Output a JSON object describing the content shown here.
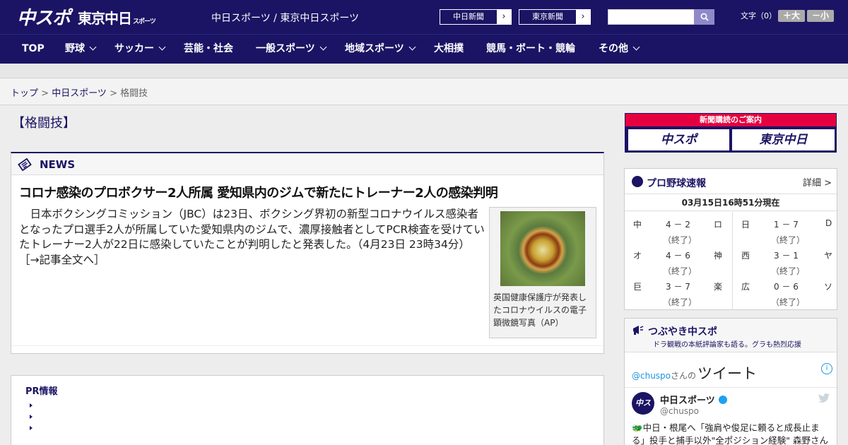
{
  "header": {
    "logo_main": "中スポ",
    "logo_tokyo": "東京中日",
    "logo_tokyo_small": "スポーツ",
    "site_title": "中日スポーツ / 東京中日スポーツ",
    "links": [
      {
        "label": "中日新聞",
        "arrow": "›"
      },
      {
        "label": "東京新聞",
        "arrow": "›"
      }
    ],
    "search_placeholder": "",
    "font_label": "文字（0）",
    "font_up": "＋大",
    "font_down": "－小"
  },
  "nav": {
    "items": [
      {
        "label": "TOP"
      },
      {
        "label": "野球"
      },
      {
        "label": "サッカー"
      },
      {
        "label": "芸能・社会"
      },
      {
        "label": "一般スポーツ"
      },
      {
        "label": "地域スポーツ"
      },
      {
        "label": "大相撲"
      },
      {
        "label": "競馬・ボート・競輪"
      },
      {
        "label": "その他"
      }
    ]
  },
  "breadcrumb": {
    "top": "トップ",
    "sep1": " > ",
    "section": "中日スポーツ",
    "sep2": " > ",
    "current": "格闘技"
  },
  "page_title": "【格闘技】",
  "news": {
    "label": "NEWS",
    "headline": "コロナ感染のプロボクサー2人所属 愛知県内のジムで新たにトレーナー2人の感染判明",
    "body": "日本ボクシングコミッション（JBC）は23日、ボクシング界初の新型コロナウイルス感染者となったプロ選手2人が所属していた愛知県内のジムで、濃厚接触者としてPCR検査を受けていたトレーナー2人が22日に感染していたことが判明したと発表した。（4月23日 23時34分）",
    "more_link": "［→記事全文へ］",
    "photo_caption": "英国健康保護庁が発表したコロナウイルスの電子顕微鏡写真（AP）"
  },
  "pr": {
    "title": "PR情報"
  },
  "subscription": {
    "title": "新聞購読のご案内",
    "left": "中スポ",
    "right": "東京中日"
  },
  "baseball": {
    "title": "プロ野球速報",
    "more": "詳細 >",
    "time": "03月15日16時51分現在",
    "games": [
      {
        "home": "中",
        "score": "4 － 2",
        "away": "ロ",
        "status": "（終了）"
      },
      {
        "home": "日",
        "score": "1 － 7",
        "away": "D",
        "status": "（終了）"
      },
      {
        "home": "オ",
        "score": "4 － 6",
        "away": "神",
        "status": "（終了）"
      },
      {
        "home": "西",
        "score": "3 － 1",
        "away": "ヤ",
        "status": "（終了）"
      },
      {
        "home": "巨",
        "score": "3 － 7",
        "away": "楽",
        "status": "（終了）"
      },
      {
        "home": "広",
        "score": "0 － 6",
        "away": "ソ",
        "status": "（終了）"
      }
    ]
  },
  "twitter": {
    "title": "つぶやき中スポ",
    "subtitle": "ドラ観戦の本紙評論家も語る。グラも熱烈応援",
    "handle": "@chuspo",
    "handle_suffix": "さんの",
    "big": "ツイート",
    "info": "i",
    "avatar_text": "中スポ",
    "name": "中日スポーツ",
    "screen_name": "@chuspo",
    "tweet": "🐲中日・根尾へ「強肩や俊足に頼ると成長止まる」投手と捕手以外\"全ポジション経験\" 森野さんか"
  },
  "colors": {
    "brand_navy": "#1b1464",
    "accent_red": "#e50040",
    "twitter_blue": "#1da1f2"
  }
}
